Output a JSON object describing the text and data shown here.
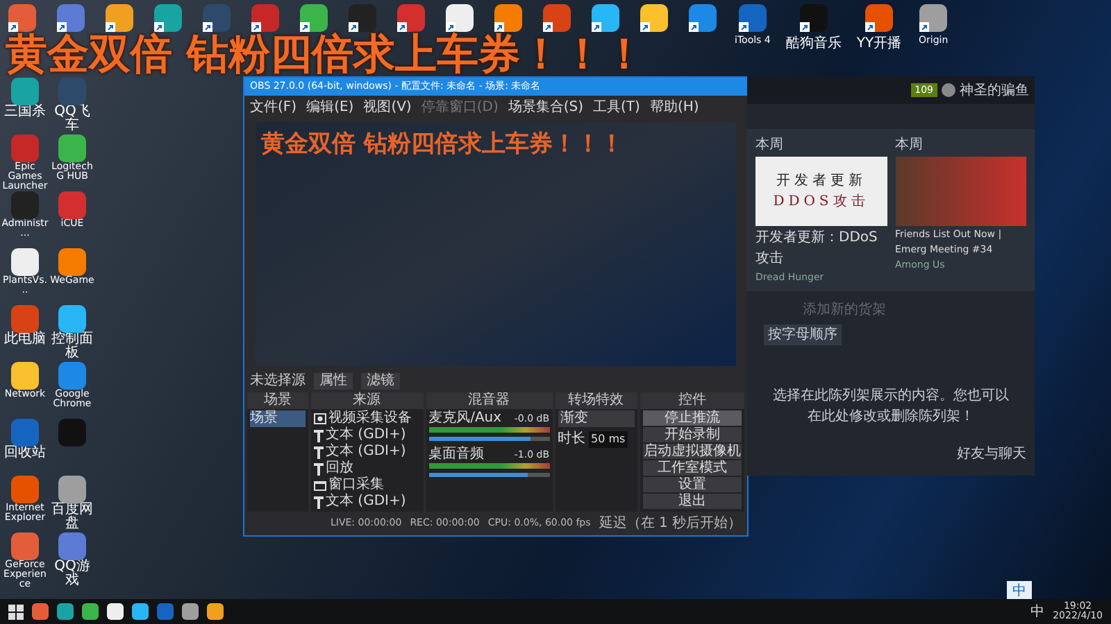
{
  "overlay_text": "黄金双倍 钻粉四倍求上车券！！！",
  "top_icons": [
    {
      "shortcut": true
    },
    {
      "shortcut": true
    },
    {
      "shortcut": true
    },
    {
      "shortcut": true
    },
    {
      "shortcut": true
    },
    {
      "shortcut": true
    },
    {
      "shortcut": true
    },
    {
      "shortcut": true
    },
    {
      "shortcut": true
    },
    {
      "shortcut": true
    },
    {
      "shortcut": true
    },
    {
      "shortcut": true
    },
    {
      "shortcut": true
    },
    {
      "shortcut": true
    },
    {
      "shortcut": true
    },
    {
      "label": "iTools 4",
      "shortcut": true
    },
    {
      "label": "酷狗音乐",
      "shortcut": true
    },
    {
      "label": "YY开播",
      "shortcut": true
    },
    {
      "label": "Origin",
      "shortcut": true
    }
  ],
  "left_icons": [
    {
      "label": "三国杀"
    },
    {
      "label": "QQ飞车"
    },
    {
      "label": "Epic Games Launcher"
    },
    {
      "label": "Logitech G HUB"
    },
    {
      "label": "Administr..."
    },
    {
      "label": "iCUE"
    },
    {
      "label": "PlantsVs..."
    },
    {
      "label": "WeGame"
    },
    {
      "label": "此电脑"
    },
    {
      "label": "控制面板"
    },
    {
      "label": "Network"
    },
    {
      "label": "Google Chrome"
    },
    {
      "label": "回收站"
    },
    {
      "shortcut": false
    },
    {
      "label": "Internet Explorer"
    },
    {
      "label": "百度网盘"
    },
    {
      "label": "GeForce Experience"
    },
    {
      "label": "QQ游戏"
    }
  ],
  "obs": {
    "title": "OBS 27.0.0 (64-bit, windows) - 配置文件: 未命名 - 场景: 未命名",
    "menu": [
      {
        "label": "文件(F)",
        "disabled": false
      },
      {
        "label": "编辑(E)",
        "disabled": false
      },
      {
        "label": "视图(V)",
        "disabled": false
      },
      {
        "label": "停靠窗口(D)",
        "disabled": true
      },
      {
        "label": "场景集合(S)",
        "disabled": false
      },
      {
        "label": "工具(T)",
        "disabled": false
      },
      {
        "label": "帮助(H)",
        "disabled": false
      }
    ],
    "preview": {
      "overlay_text": "黄金双倍 钻粉四倍求上车券！！！"
    },
    "source_status": "未选择源",
    "source_buttons": [
      "属性",
      "滤镜"
    ],
    "scenes": {
      "title": "场景",
      "items": [
        {
          "label": "场景",
          "selected": true
        }
      ]
    },
    "sources": {
      "title": "来源",
      "items": [
        {
          "label": "视频采集设备",
          "kind": "camera"
        },
        {
          "label": "文本 (GDI+)",
          "kind": "text"
        },
        {
          "label": "文本 (GDI+)",
          "kind": "text"
        },
        {
          "label": "回放",
          "kind": "text"
        },
        {
          "label": "窗口采集",
          "kind": "window"
        },
        {
          "label": "文本 (GDI+)",
          "kind": "text"
        }
      ]
    },
    "mixer": {
      "title": "混音器",
      "channels": [
        {
          "name": "麦克风/Aux",
          "reading": "-0.0 dB",
          "level": 0.85
        },
        {
          "name": "桌面音频",
          "reading": "-1.0 dB",
          "level": 0.82
        }
      ]
    },
    "transitions": {
      "title": "转场特效",
      "type": "渐变",
      "duration_label": "时长",
      "duration": "50 ms"
    },
    "controls": {
      "title": "控件",
      "buttons": [
        {
          "label": "停止推流",
          "active": true
        },
        {
          "label": "开始录制",
          "active": false
        },
        {
          "label": "启动虚拟摄像机",
          "active": false
        },
        {
          "label": "工作室模式",
          "active": false
        },
        {
          "label": "设置",
          "active": false
        },
        {
          "label": "退出",
          "active": false
        }
      ]
    },
    "status": {
      "live": "LIVE: 00:00:00",
      "rec": "REC: 00:00:00",
      "cpu": "CPU: 0.0%, 60.00 fps",
      "delay": "延迟（在 1 秒后开始）"
    }
  },
  "steam": {
    "badge": "109",
    "username": "神圣的骗鱼",
    "cards": [
      {
        "period": "本周",
        "kind": "text-image",
        "image_lines": [
          "开发者更新",
          "DDOS攻击"
        ],
        "title": "开发者更新：DDoS攻击",
        "game": "Dread Hunger"
      },
      {
        "period": "本周",
        "kind": "photo",
        "title": "Friends List Out Now | Emerg Meeting #34",
        "game": "Among Us"
      }
    ],
    "add_shelf": "添加新的货架",
    "sort": "按字母顺序",
    "message": "选择在此陈列架展示的内容。您也可以在此处修改或删除陈列架！",
    "friends": "好友与聊天"
  },
  "ime": "中",
  "tray": {
    "lang": "中",
    "time": "19:02",
    "date": "2022/4/10"
  }
}
